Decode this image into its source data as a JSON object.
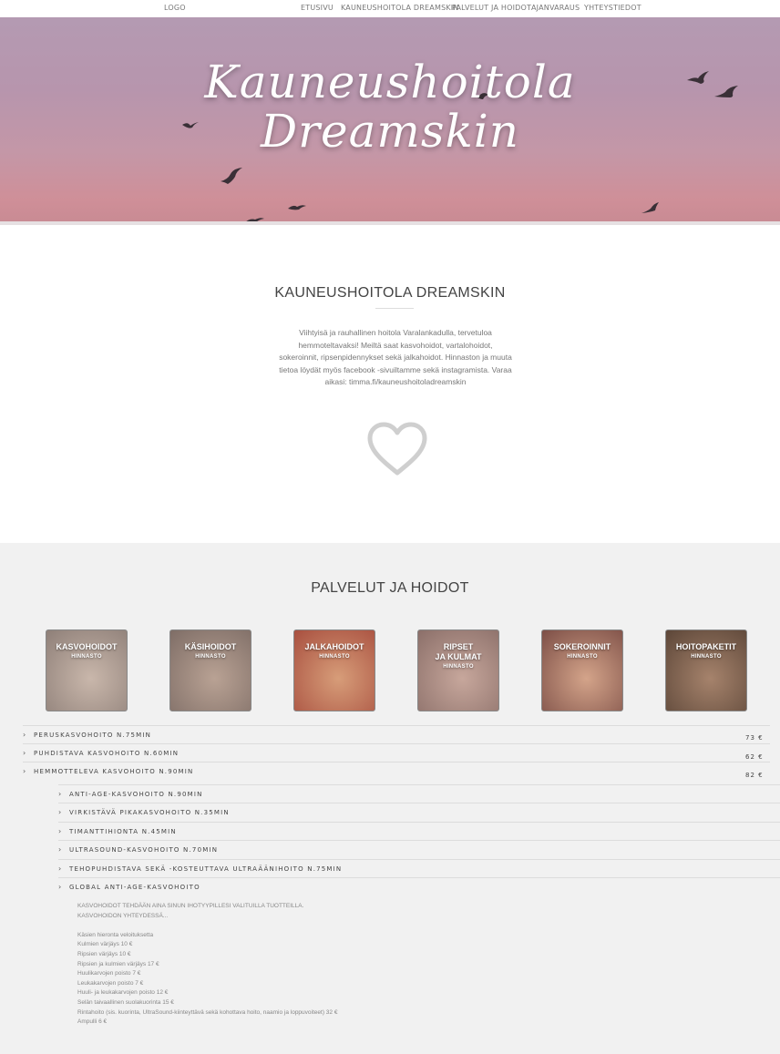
{
  "nav": {
    "logo": "LOGO",
    "items": [
      "ETUSIVU",
      "KAUNEUSHOITOLA DREAMSKIN",
      "PALVELUT JA HOIDOT",
      "AJANVARAUS",
      "YHTEYSTIEDOT"
    ]
  },
  "hero": {
    "title_line1": "Kauneushoitola",
    "title_line2": "Dreamskin"
  },
  "about": {
    "title": "KAUNEUSHOITOLA DREAMSKIN",
    "text": "Viihtyisä ja rauhallinen hoitola Varalankadulla, tervetuloa hemmoteltavaksi! Meiltä saat kasvohoidot, vartalohoidot, sokeroinnit, ripsenpidennykset sekä jalkahoidot. Hinnaston ja muuta tietoa löydät myös facebook -sivuiltamme sekä instagramista. Varaa aikasi: timma.fi/kauneushoitoladreamskin"
  },
  "services": {
    "title": "PALVELUT JA HOIDOT",
    "tiles": [
      {
        "label": "KASVOHOIDOT",
        "sub": "HINNASTO",
        "colors": [
          "#c9b7ab",
          "#8e7f78"
        ]
      },
      {
        "label": "KÄSIHOIDOT",
        "sub": "HINNASTO",
        "colors": [
          "#b9a294",
          "#7e6d66"
        ]
      },
      {
        "label": "JALKAHOIDOT",
        "sub": "HINNASTO",
        "colors": [
          "#d79d79",
          "#a84f3f"
        ]
      },
      {
        "label": "RIPSET\nJA KULMAT",
        "sub": "HINNASTO",
        "colors": [
          "#c7a79c",
          "#8b6f69"
        ]
      },
      {
        "label": "SOKEROINNIT",
        "sub": "HINNASTO",
        "colors": [
          "#d4a48a",
          "#7c4e46"
        ]
      },
      {
        "label": "HOITOPAKETIT",
        "sub": "HINNASTO",
        "colors": [
          "#a6836c",
          "#5c4638"
        ]
      }
    ]
  },
  "price_list": {
    "main": [
      {
        "name": "PERUSKASVOHOITO N.75MIN",
        "price": "73 €"
      },
      {
        "name": "PUHDISTAVA KASVOHOITO N.60MIN",
        "price": "62 €"
      },
      {
        "name": "HEMMOTTELEVA KASVOHOITO N.90MIN",
        "price": "82 €"
      }
    ],
    "sub": [
      "ANTI-AGE-KASVOHOITO N.90MIN",
      "VIRKISTÄVÄ PIKAKASVOHOITO N.35MIN",
      "TIMANTTIHIONTA N.45MIN",
      "ULTRASOUND-KASVOHOITO N.70MIN",
      "TEHOPUHDISTAVA SEKÄ -KOSTEUTTAVA ULTRAÄÄNIHOITO N.75MIN",
      "GLOBAL ANTI-AGE-KASVOHOITO"
    ]
  },
  "details": {
    "intro": [
      "KASVOHOIDOT TEHDÄÄN AINA SINUN IHOTYYPILLESI VALITUILLA TUOTTEILLA.",
      "KASVOHOIDON YHTEYDESSÄ..."
    ],
    "lines": [
      "Käsien hieronta veloituksetta",
      "Kulmien värjäys 10 €",
      "Ripsien värjäys 10 €",
      "Ripsien ja kulmien värjäys 17 €",
      "Huulikarvojen poisto 7 €",
      "Leukakarvojen poisto 7 €",
      "Huuli- ja leukakarvojen poisto 12 €",
      "Selän taivaallinen suolakuorinta 15 €",
      "Rintahoito (sis. kuorinta, UltraSound-kiinteyttävä sekä kohottava hoito, naamio ja loppuvoiteet) 32 €",
      "Ampulli 6 €"
    ]
  }
}
